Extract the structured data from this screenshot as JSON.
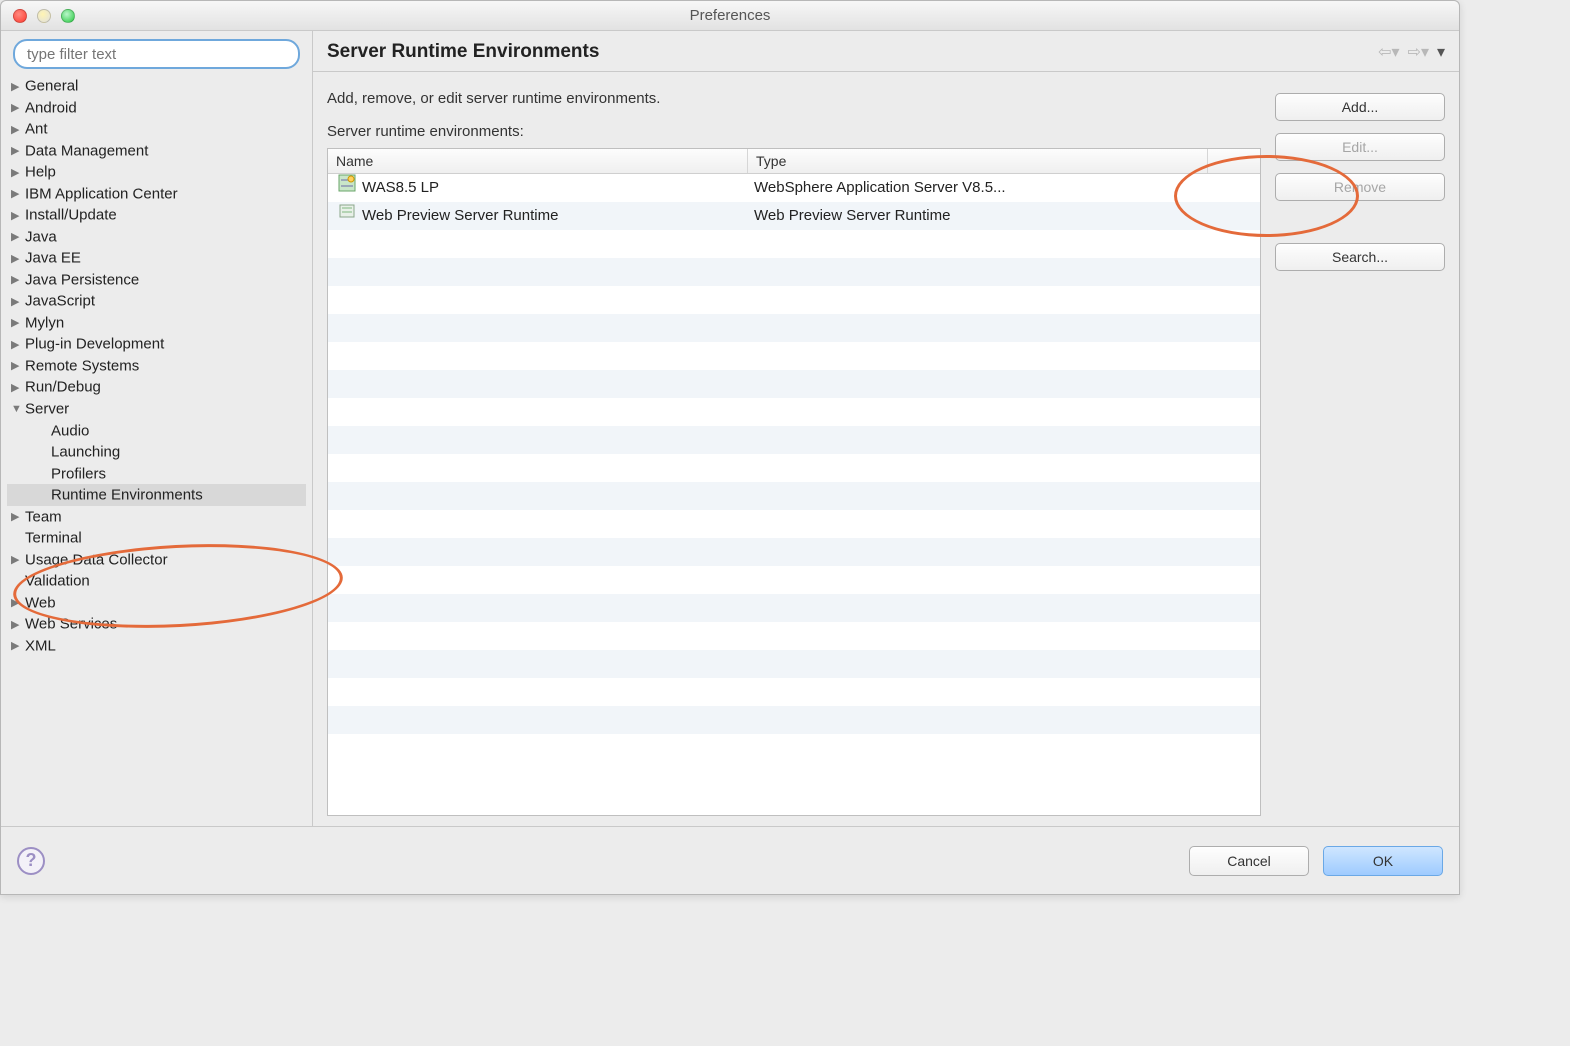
{
  "window": {
    "title": "Preferences"
  },
  "filter": {
    "placeholder": "type filter text"
  },
  "tree": {
    "items": [
      {
        "label": "General",
        "expanded": false
      },
      {
        "label": "Android",
        "expanded": false
      },
      {
        "label": "Ant",
        "expanded": false
      },
      {
        "label": "Data Management",
        "expanded": false
      },
      {
        "label": "Help",
        "expanded": false
      },
      {
        "label": "IBM Application Center",
        "expanded": false
      },
      {
        "label": "Install/Update",
        "expanded": false
      },
      {
        "label": "Java",
        "expanded": false
      },
      {
        "label": "Java EE",
        "expanded": false
      },
      {
        "label": "Java Persistence",
        "expanded": false
      },
      {
        "label": "JavaScript",
        "expanded": false
      },
      {
        "label": "Mylyn",
        "expanded": false
      },
      {
        "label": "Plug-in Development",
        "expanded": false
      },
      {
        "label": "Remote Systems",
        "expanded": false
      },
      {
        "label": "Run/Debug",
        "expanded": false
      }
    ],
    "server": {
      "label": "Server",
      "children": [
        {
          "label": "Audio"
        },
        {
          "label": "Launching"
        },
        {
          "label": "Profilers"
        },
        {
          "label": "Runtime Environments",
          "selected": true
        }
      ]
    },
    "after": [
      {
        "label": "Team",
        "expanded": false
      },
      {
        "label": "Terminal",
        "leaf": true
      },
      {
        "label": "Usage Data Collector",
        "expanded": false
      },
      {
        "label": "Validation",
        "leaf": true
      },
      {
        "label": "Web",
        "expanded": false
      },
      {
        "label": "Web Services",
        "expanded": false
      },
      {
        "label": "XML",
        "expanded": false
      }
    ]
  },
  "page": {
    "title": "Server Runtime Environments",
    "description": "Add, remove, or edit server runtime environments.",
    "list_label": "Server runtime environments:",
    "columns": {
      "name": "Name",
      "type": "Type"
    },
    "rows": [
      {
        "name": "WAS8.5 LP",
        "type": "WebSphere Application Server V8.5...",
        "icon": "was"
      },
      {
        "name": "Web Preview Server Runtime",
        "type": "Web Preview Server Runtime",
        "icon": "generic"
      }
    ],
    "buttons": {
      "add": "Add...",
      "edit": "Edit...",
      "remove": "Remove",
      "search": "Search..."
    }
  },
  "footer": {
    "cancel": "Cancel",
    "ok": "OK"
  }
}
